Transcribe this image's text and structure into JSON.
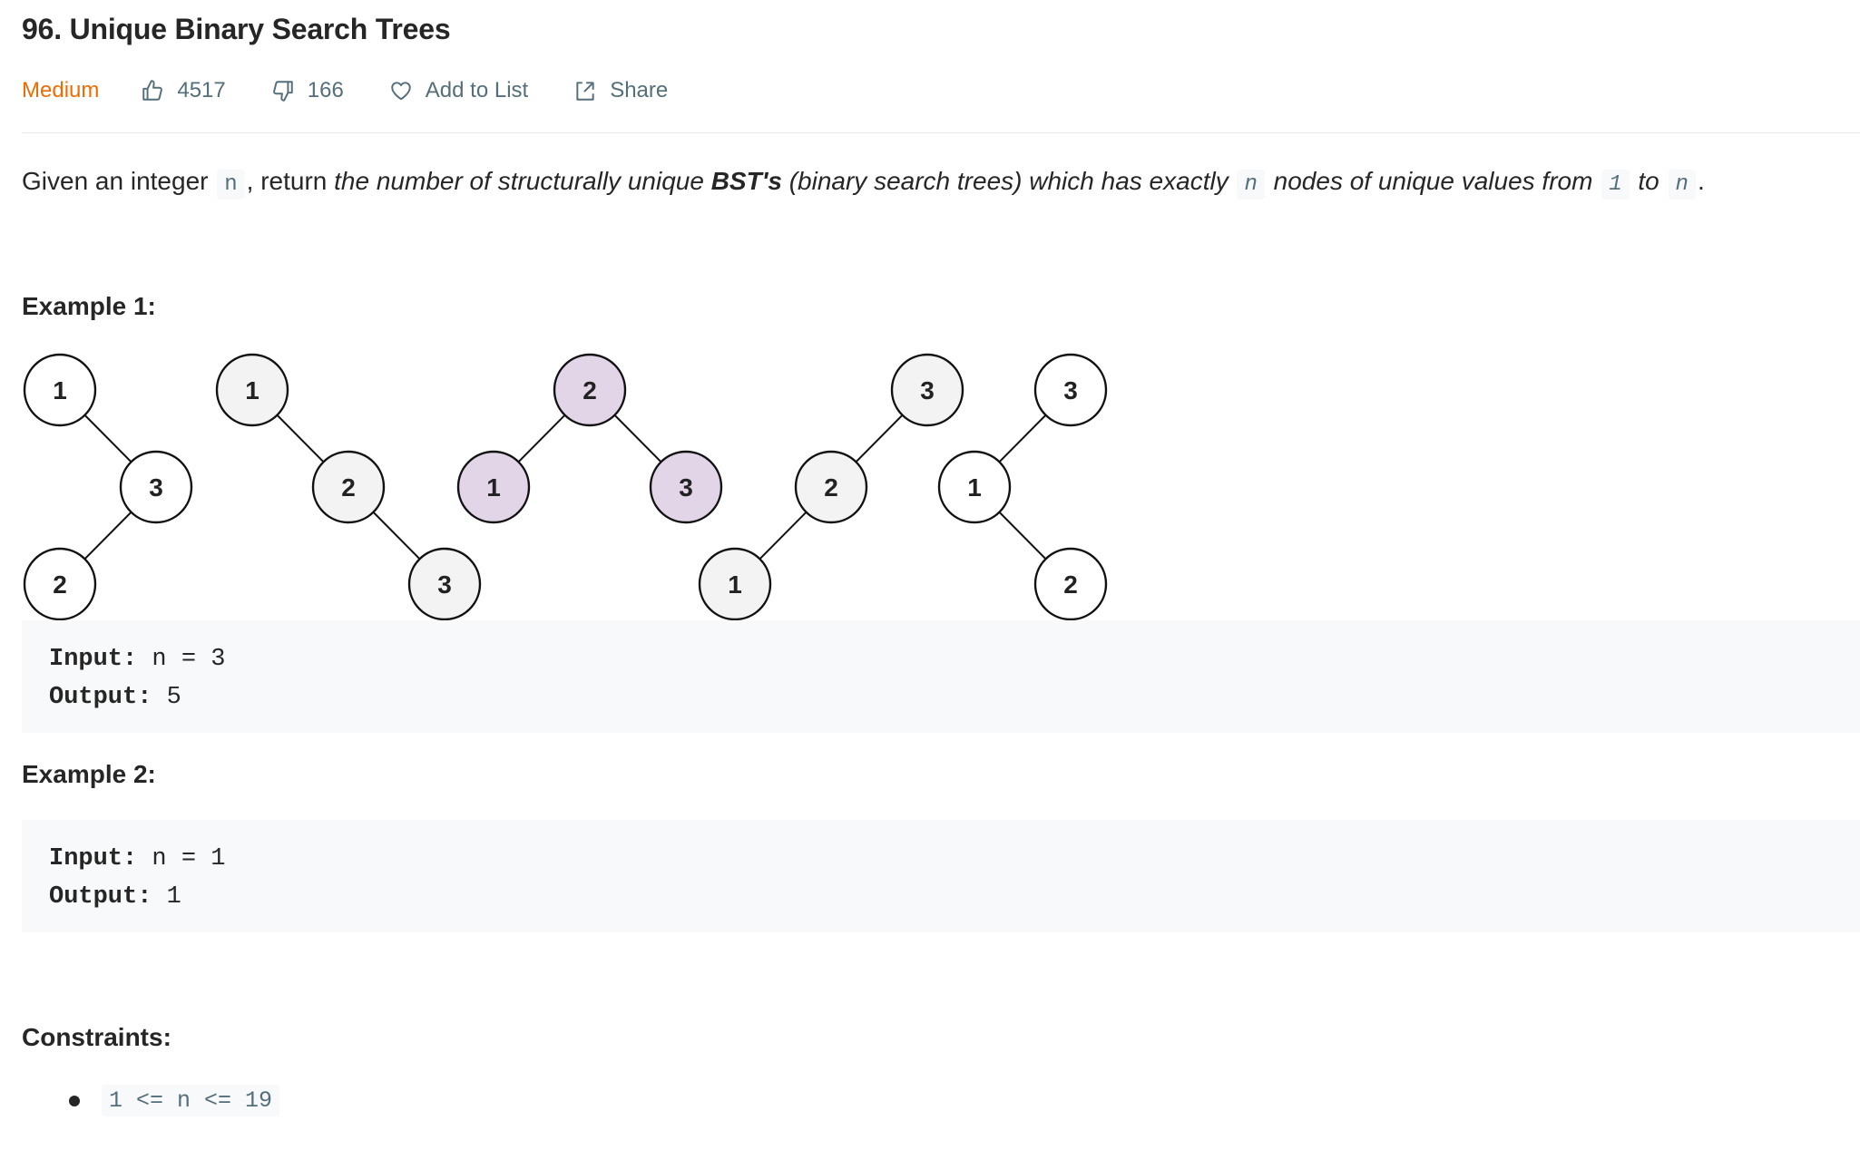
{
  "title": "96. Unique Binary Search Trees",
  "meta": {
    "difficulty": "Medium",
    "likes": "4517",
    "dislikes": "166",
    "add_to_list": "Add to List",
    "share": "Share",
    "icons": [
      "thumbs-up-icon",
      "thumbs-down-icon",
      "heart-icon",
      "share-icon"
    ]
  },
  "description": {
    "p1": "Given an integer ",
    "c1": "n",
    "p2": ", return ",
    "i1": "the number of structurally unique ",
    "b1": "BST's",
    "i2": " (binary search trees) which has exactly ",
    "c2": "n",
    "i3": " nodes of unique values from ",
    "c3": "1",
    "i4": " to ",
    "c4": "n",
    "p3": "."
  },
  "example1": {
    "heading": "Example 1:",
    "input_label": "Input:",
    "input_value": " n = 3",
    "output_label": "Output:",
    "output_value": " 5"
  },
  "trees": {
    "colors": {
      "white": "#ffffff",
      "gray": "#f3f3f3",
      "purple": "#e2d5e8",
      "stroke": "#111111"
    },
    "nodes": [
      {
        "label": "1",
        "fill": "white"
      },
      {
        "label": "3",
        "fill": "white"
      },
      {
        "label": "2",
        "fill": "white"
      },
      {
        "label": "1",
        "fill": "gray"
      },
      {
        "label": "2",
        "fill": "gray"
      },
      {
        "label": "3",
        "fill": "gray"
      },
      {
        "label": "2",
        "fill": "purple"
      },
      {
        "label": "1",
        "fill": "purple"
      },
      {
        "label": "3",
        "fill": "purple"
      },
      {
        "label": "3",
        "fill": "gray"
      },
      {
        "label": "2",
        "fill": "gray"
      },
      {
        "label": "1",
        "fill": "gray"
      },
      {
        "label": "3",
        "fill": "white"
      },
      {
        "label": "1",
        "fill": "white"
      },
      {
        "label": "2",
        "fill": "white"
      }
    ]
  },
  "example2": {
    "heading": "Example 2:",
    "input_label": "Input:",
    "input_value": " n = 1",
    "output_label": "Output:",
    "output_value": " 1"
  },
  "constraints": {
    "heading": "Constraints:",
    "items": [
      "1 <= n <= 19"
    ]
  }
}
